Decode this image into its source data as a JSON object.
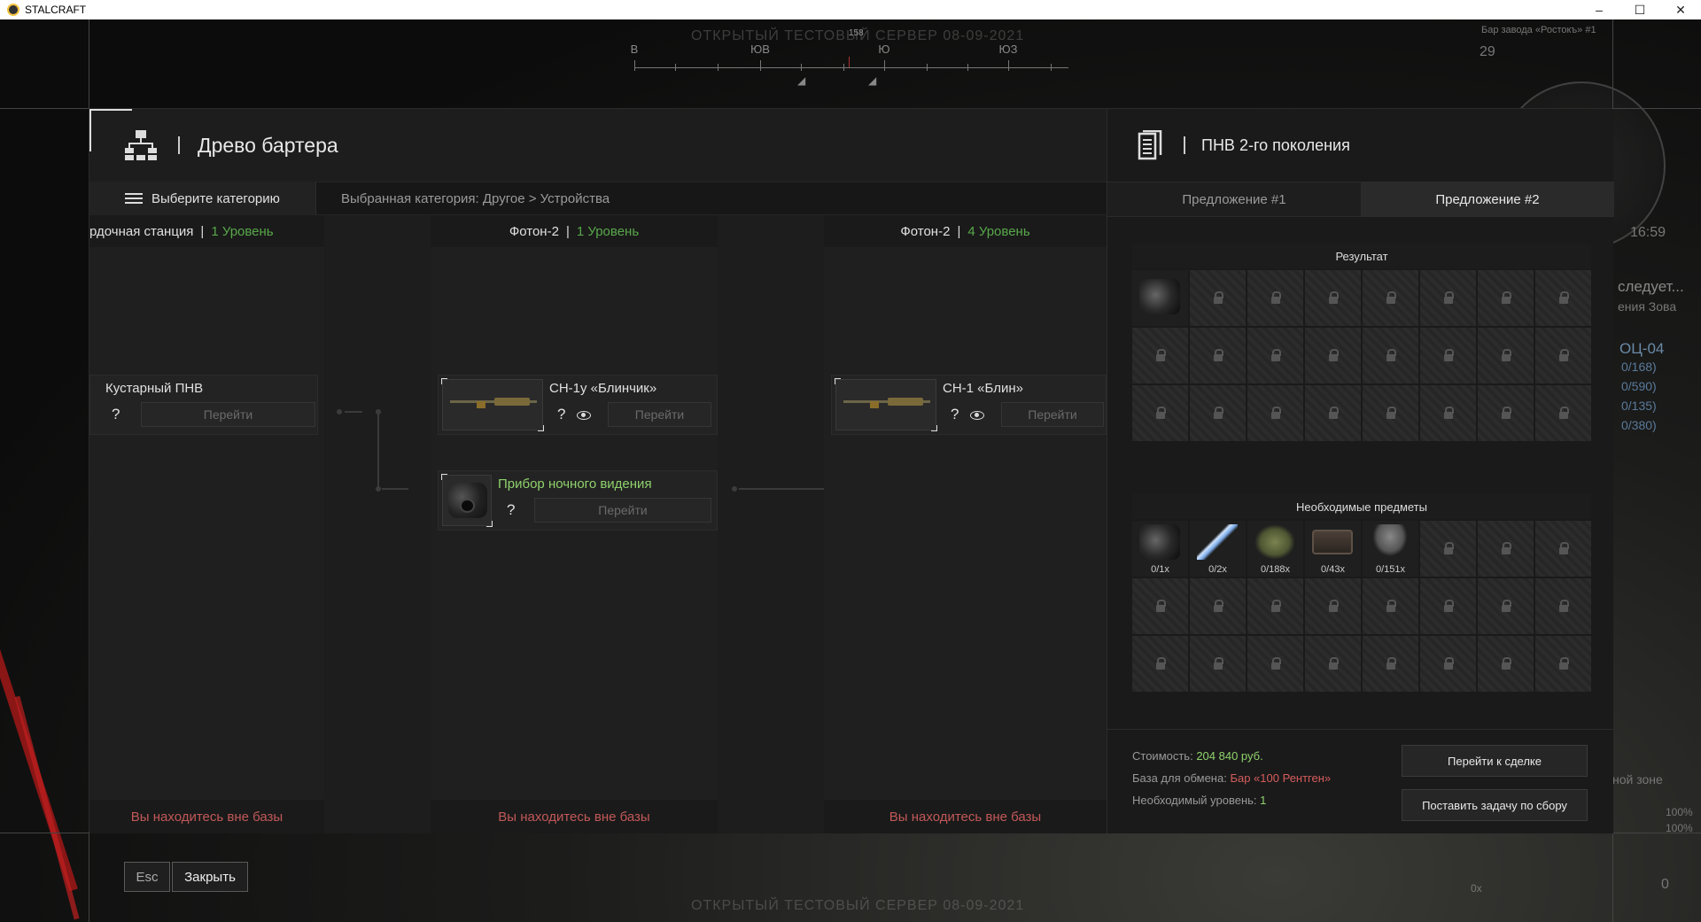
{
  "window": {
    "title": "STALCRAFT",
    "minimize": "–",
    "maximize": "☐",
    "close": "✕"
  },
  "hud": {
    "watermark": "ОТКРЫТЫЙ ТЕСТОВЫЙ СЕРВЕР 08-09-2021",
    "compass": {
      "degree": "158",
      "labels": [
        "В",
        "ЮВ",
        "Ю",
        "ЮЗ"
      ]
    },
    "location": "Бар завода «Ростокъ» #1",
    "time": "16:59",
    "players": "29",
    "quest_title": "следует...",
    "quest_sub": "ения Зова",
    "weapon_name": "ОЦ-04",
    "ammo": [
      "0/168)",
      "0/590)",
      "0/135)",
      "0/380)"
    ],
    "zone": "ной зоне",
    "percent1": "100%",
    "percent2": "100%",
    "ammo_count": "0",
    "ox": "0x"
  },
  "tree": {
    "title": "Древо бартера",
    "category_button": "Выберите категорию",
    "category_path": "Выбранная категория: Другое > Устройства",
    "columns": [
      {
        "name": "рдочная станция",
        "level": "1 Уровень",
        "footer": "Вы находитесь вне базы"
      },
      {
        "name": "Фотон-2",
        "level": "1 Уровень",
        "footer": "Вы находитесь вне базы"
      },
      {
        "name": "Фотон-2",
        "level": "4 Уровень",
        "footer": "Вы находитесь вне базы"
      }
    ],
    "nodes": {
      "kustarny": {
        "name": "Кустарный ПНВ",
        "q": "?",
        "go": "Перейти"
      },
      "sn1u": {
        "name": "СН-1у «Блинчик»",
        "q": "?",
        "go": "Перейти"
      },
      "pnv": {
        "name": "Прибор ночного видения",
        "q": "?",
        "go": "Перейти"
      },
      "sn1": {
        "name": "СН-1 «Блин»",
        "q": "?",
        "go": "Перейти"
      }
    }
  },
  "detail": {
    "title": "ПНВ 2-го поколения",
    "tabs": [
      "Предложение #1",
      "Предложение #2"
    ],
    "active_tab": 1,
    "result_title": "Результат",
    "required_title": "Необходимые предметы",
    "required_items": [
      {
        "icon": "nvg-icon",
        "qty": "0/1x"
      },
      {
        "icon": "syringe-icon",
        "qty": "0/2x"
      },
      {
        "icon": "leaf-icon",
        "qty": "0/188x"
      },
      {
        "icon": "case-icon",
        "qty": "0/43x"
      },
      {
        "icon": "mushroom-icon",
        "qty": "0/151x"
      }
    ],
    "cost_label": "Стоимость:",
    "cost_value": "204 840 руб.",
    "base_label": "База для обмена:",
    "base_value": "Бар «100 Рентген»",
    "level_label": "Необходимый уровень:",
    "level_value": "1",
    "go_deal": "Перейти к сделке",
    "set_task": "Поставить задачу по сбору"
  },
  "bottom": {
    "esc": "Esc",
    "close": "Закрыть"
  },
  "colors": {
    "accent_green": "#58a84a",
    "warn_red": "#c25858",
    "bg": "#1d1d1d"
  }
}
